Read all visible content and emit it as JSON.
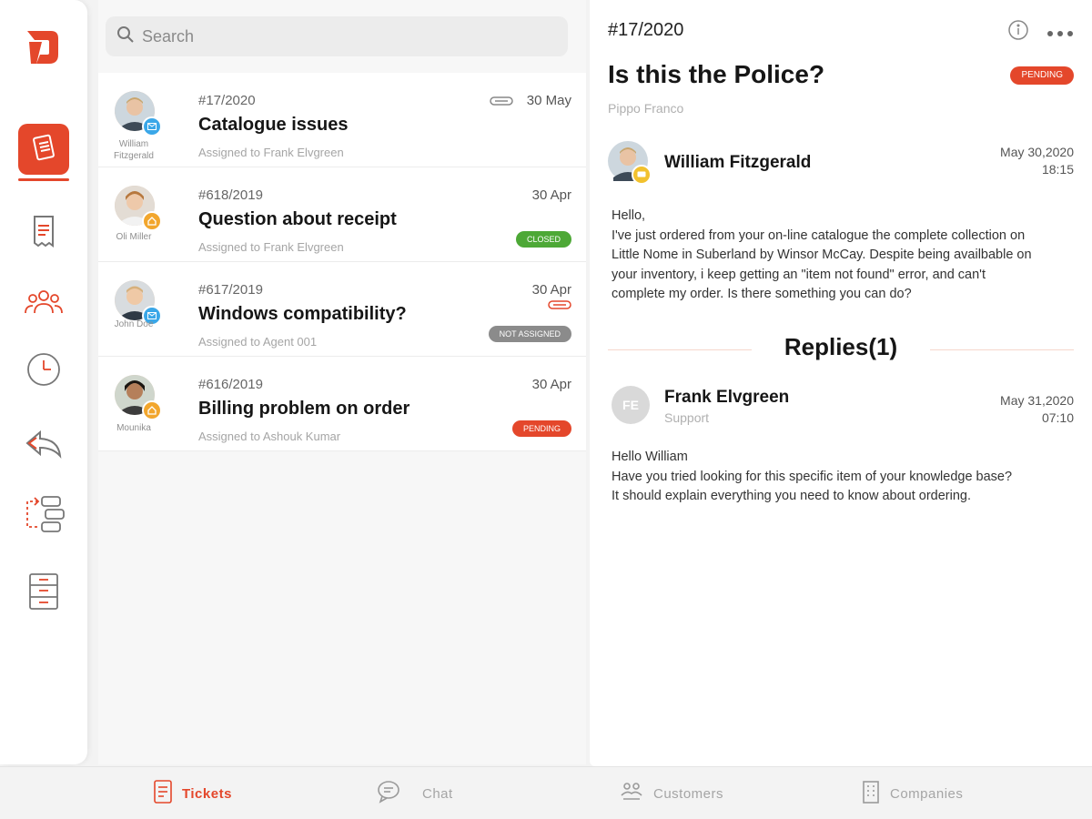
{
  "search": {
    "placeholder": "Search"
  },
  "tickets": [
    {
      "id": "#17/2020",
      "title": "Catalogue issues",
      "assigned": "Assigned to Frank Elvgreen",
      "date": "30 May",
      "person": "William Fitzgerald",
      "channel": "mail",
      "status": ""
    },
    {
      "id": "#618/2019",
      "title": "Question about receipt",
      "assigned": "Assigned to Frank Elvgreen",
      "date": "30 Apr",
      "person": "Oli Miller",
      "channel": "home",
      "status": "CLOSED"
    },
    {
      "id": "#617/2019",
      "title": "Windows compatibility?",
      "assigned": "Assigned to Agent 001",
      "date": "30 Apr",
      "person": "John Doe",
      "channel": "mail",
      "status": "NOT ASSIGNED"
    },
    {
      "id": "#616/2019",
      "title": "Billing problem on order",
      "assigned": "Assigned to Ashouk Kumar",
      "date": "30 Apr",
      "person": "Mounika",
      "channel": "home",
      "status": "PENDING"
    }
  ],
  "detail": {
    "id": "#17/2020",
    "title": "Is this the Police?",
    "status": "PENDING",
    "requester": "Pippo Franco",
    "author": "William Fitzgerald",
    "date": "May 30,2020",
    "time": "18:15",
    "body": [
      "Hello,",
      "I've just ordered from your on-line catalogue the complete collection on",
      "Little Nome in Suberland by Winsor McCay. Despite being availbable on",
      "your inventory, i keep getting an \"item not found\" error, and can't",
      "complete my order. Is there something you can do?"
    ],
    "replies_title": "Replies(1)",
    "reply": {
      "initials": "FE",
      "name": "Frank Elvgreen",
      "role": "Support",
      "date": "May 31,2020",
      "time": "07:10",
      "body": [
        "Hello William",
        "Have you tried looking for this specific item of your knowledge base?",
        "It should explain everything you need to know about ordering."
      ]
    }
  },
  "tabs": [
    {
      "label": "Tickets",
      "icon": "ticket-icon",
      "active": true
    },
    {
      "label": "Chat",
      "icon": "chat-icon",
      "active": false
    },
    {
      "label": "Customers",
      "icon": "customers-icon",
      "active": false
    },
    {
      "label": "Companies",
      "icon": "companies-icon",
      "active": false
    }
  ],
  "colors": {
    "accent": "#e4472b",
    "closed": "#4da836",
    "not_assigned": "#8b8b8b",
    "mail_badge": "#3aa7e8",
    "home_badge": "#f2a62d"
  }
}
